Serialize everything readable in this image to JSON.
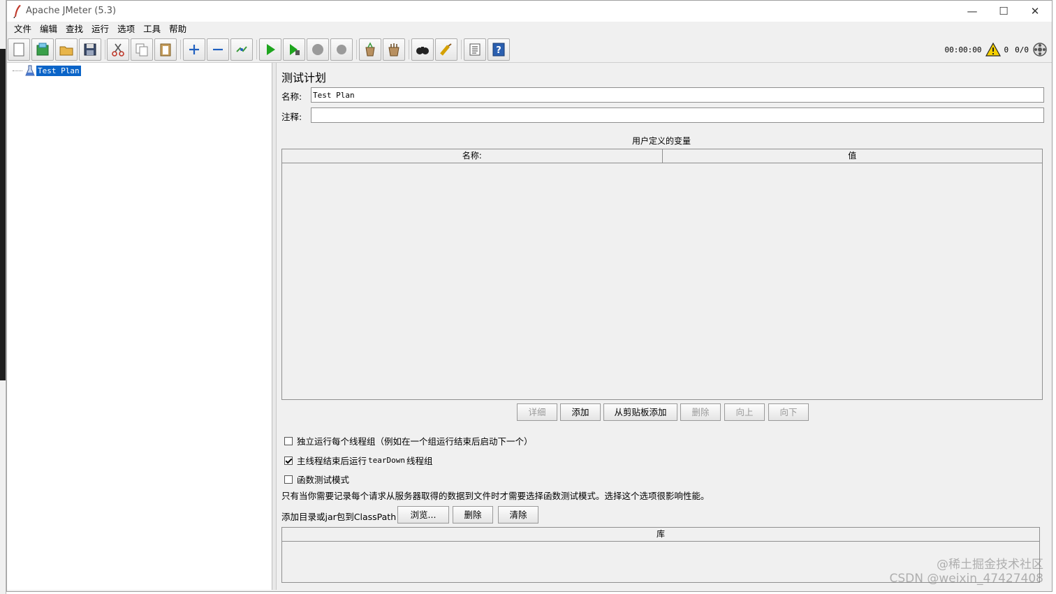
{
  "window": {
    "title": "Apache JMeter (5.3)",
    "controls": {
      "minimize": "—",
      "maximize": "☐",
      "close": "✕"
    }
  },
  "menu": [
    "文件",
    "编辑",
    "查找",
    "运行",
    "选项",
    "工具",
    "帮助"
  ],
  "toolbar": {
    "buttons": [
      "new-icon",
      "templates-icon",
      "open-icon",
      "save-icon",
      "cut-icon",
      "copy-icon",
      "paste-icon",
      "expand-icon",
      "collapse-icon",
      "toggle-icon",
      "start-icon",
      "start-no-pause-icon",
      "stop-icon",
      "shutdown-icon",
      "clear-icon",
      "clear-all-icon",
      "search-icon",
      "reset-search-icon",
      "function-helper-icon",
      "help-icon"
    ],
    "timer": "00:00:00",
    "warning_count": "0",
    "threads": "0/0"
  },
  "tree": {
    "root_label": "Test Plan"
  },
  "test_plan": {
    "heading": "测试计划",
    "name_label": "名称:",
    "name_value": "Test Plan",
    "comment_label": "注释:",
    "comment_value": "",
    "variables_caption": "用户定义的变量",
    "variables_columns": [
      "名称:",
      "值"
    ],
    "variable_buttons": [
      {
        "label": "详细",
        "enabled": false
      },
      {
        "label": "添加",
        "enabled": true
      },
      {
        "label": "从剪贴板添加",
        "enabled": true
      },
      {
        "label": "删除",
        "enabled": false
      },
      {
        "label": "向上",
        "enabled": false
      },
      {
        "label": "向下",
        "enabled": false
      }
    ],
    "options": {
      "serialize_label": "独立运行每个线程组（例如在一个组运行结束后启动下一个）",
      "serialize_checked": false,
      "teardown_label_pre": "主线程结束后运行 ",
      "teardown_label_mono": "tearDown",
      "teardown_label_post": "线程组",
      "teardown_checked": true,
      "functional_label": "函数测试模式",
      "functional_checked": false
    },
    "functional_note": "只有当你需要记录每个请求从服务器取得的数据到文件时才需要选择函数测试模式。选择这个选项很影响性能。",
    "classpath_label": "添加目录或jar包到ClassPath",
    "classpath_buttons": [
      "浏览...",
      "删除",
      "清除"
    ],
    "library_column": "库"
  },
  "watermark": {
    "line1": "@稀土掘金技术社区",
    "line2": "CSDN @weixin_47427408"
  }
}
